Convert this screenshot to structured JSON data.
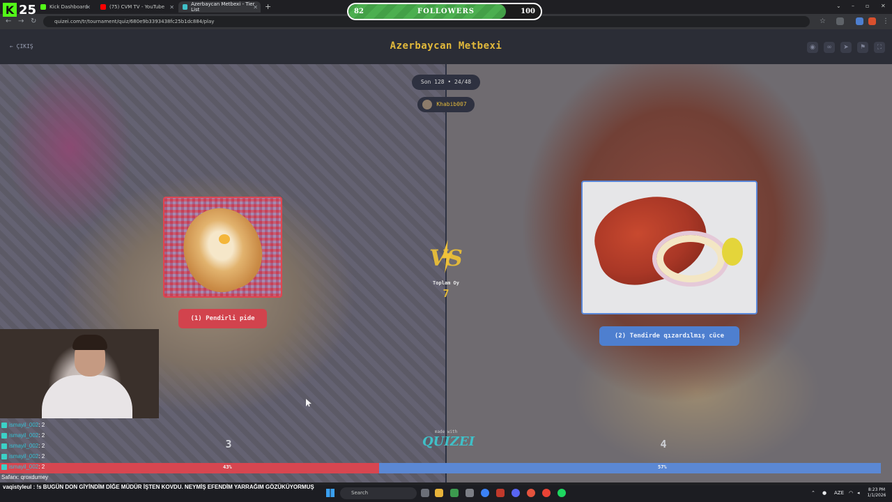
{
  "browser": {
    "tabs": [
      {
        "title": "Kick Dashboard"
      },
      {
        "title": "(75) CVM TV - YouTube"
      },
      {
        "title": "Azerbaycan Metbexi - Tier List"
      }
    ],
    "url": "quizei.com/tr/tournament/quiz/680e9b3393438fc25b1dc884/play"
  },
  "kick": {
    "badge": "K",
    "count": "25"
  },
  "followers": {
    "current": "82",
    "label": "FOLLOWERS",
    "goal": "100",
    "progress": 0.82
  },
  "app": {
    "back_label": "ÇIKIŞ",
    "title": "Azerbaycan Metbexi",
    "round": "Son 128 • 24/48",
    "username": "Khabib007",
    "vs_label": "VS",
    "total_label": "Toplam Oy",
    "total_votes": "7",
    "made_with": "made with",
    "brand": "QUIZEI",
    "left": {
      "button": "(1) Pendirli pide",
      "votes": "3",
      "percent": "43%",
      "share": 0.43,
      "color": "#d74650"
    },
    "right": {
      "button": "(2) Tendirde qızardılmış cüce",
      "votes": "4",
      "percent": "57%",
      "share": 0.57,
      "color": "#5b88d4"
    }
  },
  "chat": {
    "lines": [
      {
        "user": "ismayil_002",
        "msg": ": 2"
      },
      {
        "user": "ismayil_002",
        "msg": ": 2"
      },
      {
        "user": "ismayil_002",
        "msg": ": 2"
      },
      {
        "user": "ismayil_002",
        "msg": ": 2"
      },
      {
        "user": "ismayil_002",
        "msg": ": 2"
      },
      {
        "user": "Safarx",
        "msg": ": qroxdumey"
      }
    ],
    "highlight": "vaqistyleul : !s BUGÜN DON GİYİNDİM DİĞE MÜDÜR İŞTEN KOVDU. NEYMİŞ EFENDİM YARRAĞIM GÖZÜKÜYORMUŞ"
  },
  "taskbar": {
    "search": "Search",
    "lang": "AZE",
    "time": "8:23 PM",
    "date": "1/1/2026"
  }
}
